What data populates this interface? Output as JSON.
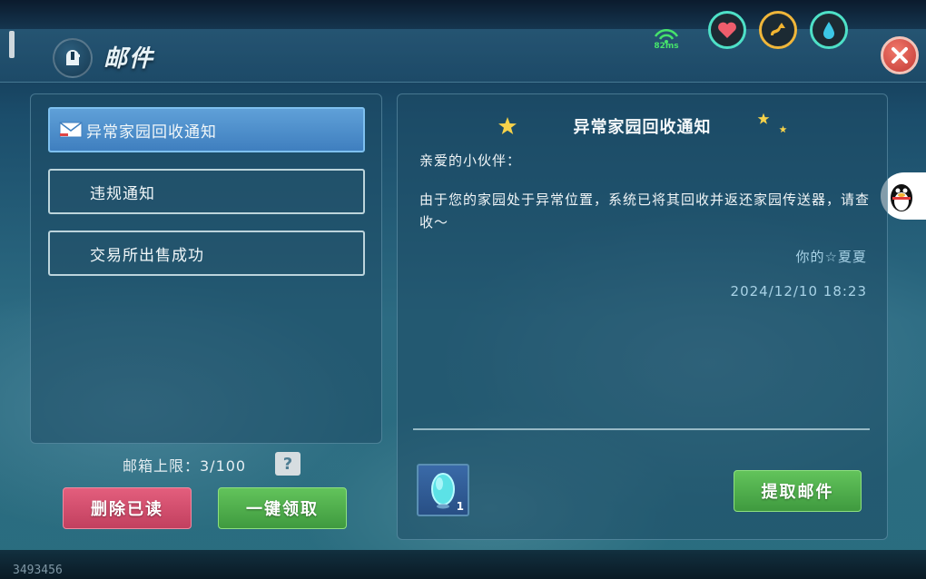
{
  "header": {
    "title": "邮件"
  },
  "status": {
    "ping": "82ms"
  },
  "mail_list": [
    {
      "label": "异常家园回收通知",
      "active": true
    },
    {
      "label": "违规通知",
      "active": false
    },
    {
      "label": "交易所出售成功",
      "active": false
    }
  ],
  "mailbox": {
    "capacity_text": "邮箱上限：3/100",
    "help_label": "?"
  },
  "actions": {
    "delete_read": "删除已读",
    "claim_all": "一键领取",
    "claim_mail": "提取邮件"
  },
  "detail": {
    "title": "异常家园回收通知",
    "greeting": "亲爱的小伙伴：",
    "body": "由于您的家园处于异常位置，系统已将其回收并返还家园传送器，请查收～",
    "signature": "你的☆夏夏",
    "date": "2024/12/10 18:23",
    "attachment_count": "1"
  },
  "footer": {
    "uid": "3493456"
  },
  "colors": {
    "accent_blue": "#4f90cf",
    "red_button": "#d24e6e",
    "green_button": "#52b04d",
    "close_red": "#d9504a"
  },
  "icons": [
    "mail-badge-icon",
    "wifi-icon",
    "heart-icon",
    "stamina-icon",
    "water-icon",
    "close-icon",
    "envelope-icon",
    "star-icon",
    "qq-penguin-icon",
    "crystal-icon"
  ]
}
